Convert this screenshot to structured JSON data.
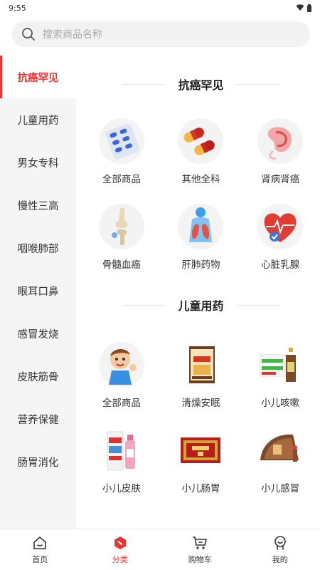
{
  "status": {
    "time": "9:55"
  },
  "search": {
    "placeholder": "搜索商品名称"
  },
  "sidebar": {
    "items": [
      {
        "label": "抗癌罕见",
        "active": true
      },
      {
        "label": "儿童用药"
      },
      {
        "label": "男女专科"
      },
      {
        "label": "慢性三高"
      },
      {
        "label": "咽喉肺部"
      },
      {
        "label": "眼耳口鼻"
      },
      {
        "label": "感冒发烧"
      },
      {
        "label": "皮肤筋骨"
      },
      {
        "label": "营养保健"
      },
      {
        "label": "肠胃消化"
      }
    ]
  },
  "sections": [
    {
      "title": "抗癌罕见",
      "items": [
        {
          "label": "全部商品",
          "icon": "pills-blister-icon"
        },
        {
          "label": "其他全科",
          "icon": "capsules-icon"
        },
        {
          "label": "肾病肾癌",
          "icon": "kidney-icon"
        },
        {
          "label": "骨髓血癌",
          "icon": "bone-joint-icon"
        },
        {
          "label": "肝肺药物",
          "icon": "lungs-icon"
        },
        {
          "label": "心脏乳腺",
          "icon": "heart-icon"
        }
      ]
    },
    {
      "title": "儿童用药",
      "items": [
        {
          "label": "全部商品",
          "icon": "child-icon"
        },
        {
          "label": "清燥安眠",
          "icon": "medicine-box-icon"
        },
        {
          "label": "小儿咳嗽",
          "icon": "syrup-bottle-icon"
        },
        {
          "label": "小儿皮肤",
          "icon": "spray-bottle-icon"
        },
        {
          "label": "小儿肠胃",
          "icon": "red-box-icon"
        },
        {
          "label": "小儿感冒",
          "icon": "herbal-pack-icon"
        }
      ]
    }
  ],
  "tabbar": {
    "items": [
      {
        "label": "首页",
        "icon": "home-icon"
      },
      {
        "label": "分类",
        "icon": "category-icon",
        "active": true
      },
      {
        "label": "购物车",
        "icon": "cart-icon"
      },
      {
        "label": "我的",
        "icon": "profile-icon"
      }
    ]
  },
  "colors": {
    "accent": "#e33333",
    "sidebar_bg": "#f5f5f5"
  }
}
